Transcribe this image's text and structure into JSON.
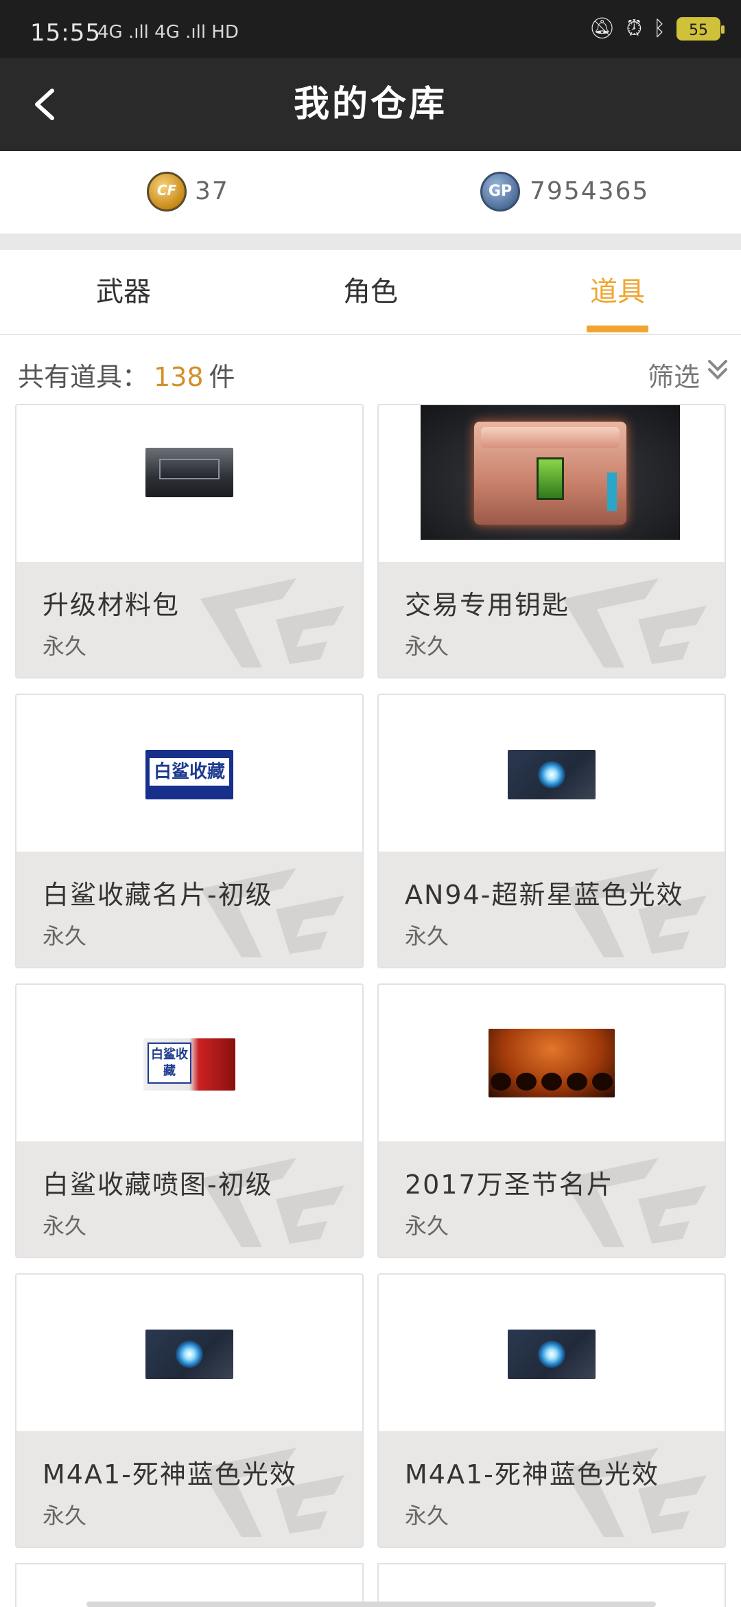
{
  "status_bar": {
    "time": "15:55",
    "signal": "4G .ıll 4G .ıll HD",
    "battery": "55"
  },
  "header": {
    "title": "我的仓库"
  },
  "currency": {
    "cf_points": "37",
    "gp_points": "7954365",
    "cf_icon_text": "CF",
    "gp_icon_text": "GP"
  },
  "tabs": [
    {
      "label": "武器",
      "active": false
    },
    {
      "label": "角色",
      "active": false
    },
    {
      "label": "道具",
      "active": true
    }
  ],
  "summary": {
    "prefix": "共有道具：",
    "count": "138",
    "suffix": "件",
    "filter_label": "筛选"
  },
  "items": [
    {
      "name": "升级材料包",
      "duration": "永久",
      "icon": "upgrade-box-icon"
    },
    {
      "name": "交易专用钥匙",
      "duration": "永久",
      "icon": "trade-key-box-icon"
    },
    {
      "name": "白鲨收藏名片-初级",
      "duration": "永久",
      "icon": "white-shark-card-icon",
      "thumb_text": "白鲨收藏"
    },
    {
      "name": "AN94-超新星蓝色光效",
      "duration": "永久",
      "icon": "blue-glow-effect-icon"
    },
    {
      "name": "白鲨收藏喷图-初级",
      "duration": "永久",
      "icon": "white-shark-spray-icon",
      "thumb_text": "白鲨收藏"
    },
    {
      "name": "2017万圣节名片",
      "duration": "永久",
      "icon": "halloween-card-icon"
    },
    {
      "name": "M4A1-死神蓝色光效",
      "duration": "永久",
      "icon": "blue-glow-effect-icon"
    },
    {
      "name": "M4A1-死神蓝色光效",
      "duration": "永久",
      "icon": "blue-glow-effect-icon"
    }
  ],
  "colors": {
    "accent": "#f0a531",
    "header_bg": "#2a2a2a",
    "card_bottom_bg": "#e9e7e5"
  }
}
